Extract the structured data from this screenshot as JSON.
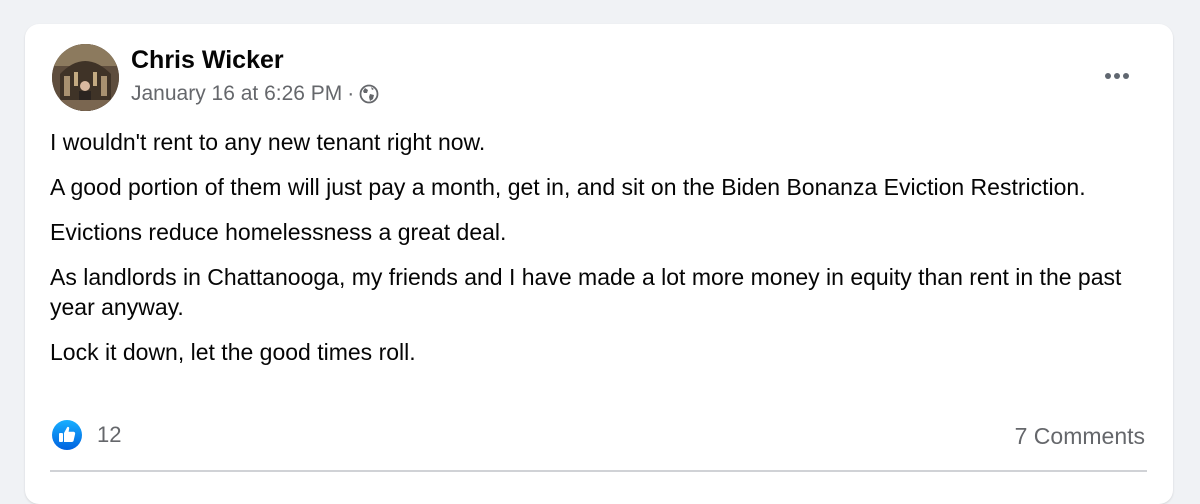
{
  "post": {
    "author": "Chris Wicker",
    "timestamp": "January 16 at 6:26 PM",
    "separator": "·",
    "audience_icon": "globe-icon",
    "more_icon": "more-horizontal-icon",
    "paragraphs": [
      "I wouldn't rent to any new tenant right now.",
      "A good portion of them will just pay a month, get in, and sit on the Biden Bonanza Eviction Restriction.",
      "Evictions reduce homelessness a great deal.",
      "As landlords in Chattanooga, my friends and I have made a lot more money in equity than rent in the past year anyway.",
      "Lock it down, let the good times roll."
    ],
    "reactions": {
      "icon": "like-icon",
      "count": "12"
    },
    "comments_label": "7 Comments"
  },
  "colors": {
    "background": "#f0f2f5",
    "card": "#ffffff",
    "text_primary": "#050505",
    "text_secondary": "#65676b",
    "like_blue": "#1877f2"
  }
}
